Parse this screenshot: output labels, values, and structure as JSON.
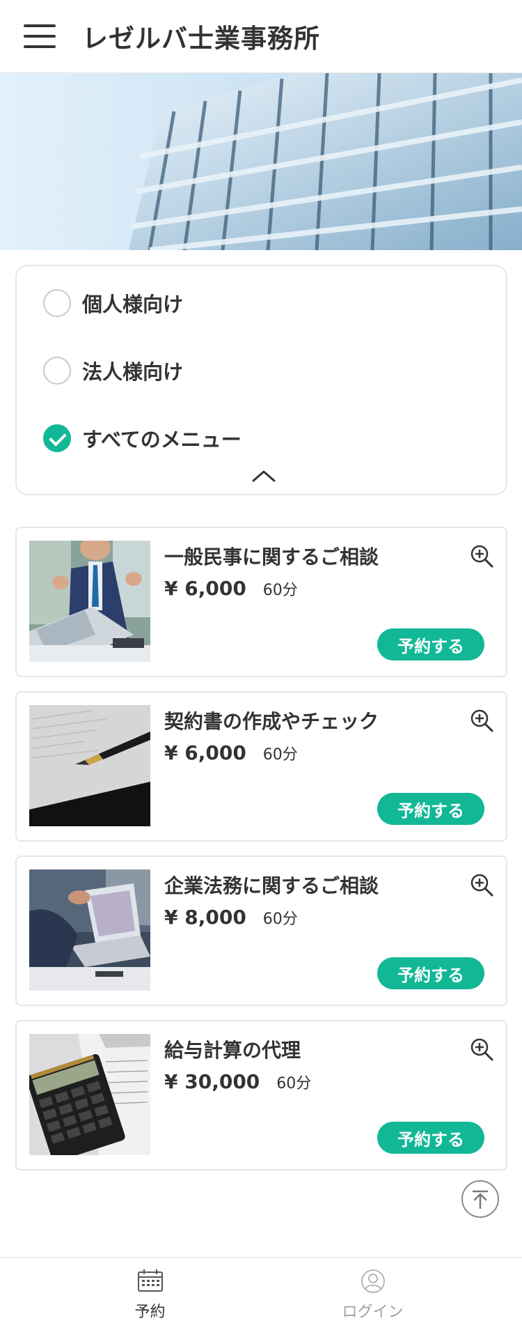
{
  "header": {
    "title": "レゼルバ士業事務所",
    "menu_icon": "hamburger-icon"
  },
  "filter": {
    "options": [
      {
        "label": "個人様向け",
        "checked": false
      },
      {
        "label": "法人様向け",
        "checked": false
      },
      {
        "label": "すべてのメニュー",
        "checked": true
      }
    ],
    "collapse_icon": "chevron-up-icon"
  },
  "menu_items": [
    {
      "title": "一般民事に関するご相談",
      "price": "¥ 6,000",
      "duration": "60分",
      "button": "予約する",
      "image": "businessman-laptop-photo"
    },
    {
      "title": "契約書の作成やチェック",
      "price": "¥ 6,000",
      "duration": "60分",
      "button": "予約する",
      "image": "pen-on-paper-photo"
    },
    {
      "title": "企業法務に関するご相談",
      "price": "¥ 8,000",
      "duration": "60分",
      "button": "予約する",
      "image": "meeting-laptop-photo"
    },
    {
      "title": "給与計算の代理",
      "price": "¥ 30,000",
      "duration": "60分",
      "button": "予約する",
      "image": "calculator-photo"
    }
  ],
  "back_to_top_icon": "arrow-up-to-top-icon",
  "bottom_nav": {
    "items": [
      {
        "label": "予約",
        "icon": "calendar-icon",
        "active": true
      },
      {
        "label": "ログイン",
        "icon": "user-icon",
        "active": false
      }
    ]
  },
  "colors": {
    "accent": "#12b896",
    "text": "#333333",
    "border": "#e6e6e6"
  }
}
